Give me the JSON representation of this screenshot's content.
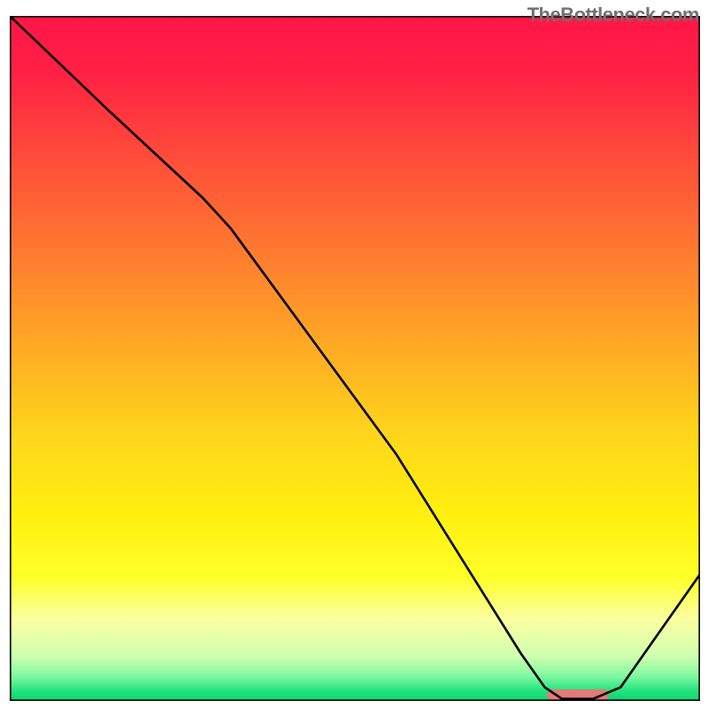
{
  "watermark_text": "TheBottleneck.com",
  "chart_data": {
    "type": "line",
    "title": "",
    "xlabel": "",
    "ylabel": "",
    "xlim": [
      0,
      100
    ],
    "ylim": [
      0,
      100
    ],
    "background_gradient": {
      "stops": [
        {
          "offset": 0.0,
          "color": "#ff1648"
        },
        {
          "offset": 0.08,
          "color": "#ff2044"
        },
        {
          "offset": 0.2,
          "color": "#ff4a3a"
        },
        {
          "offset": 0.35,
          "color": "#ff7c2f"
        },
        {
          "offset": 0.5,
          "color": "#ffb023"
        },
        {
          "offset": 0.62,
          "color": "#ffd81a"
        },
        {
          "offset": 0.73,
          "color": "#fff010"
        },
        {
          "offset": 0.82,
          "color": "#ffff28"
        },
        {
          "offset": 0.88,
          "color": "#faffa0"
        },
        {
          "offset": 0.935,
          "color": "#d0ffb0"
        },
        {
          "offset": 0.965,
          "color": "#7cf7a0"
        },
        {
          "offset": 0.985,
          "color": "#24e37e"
        },
        {
          "offset": 1.0,
          "color": "#0bd66e"
        }
      ]
    },
    "border": {
      "color": "#000000",
      "width": 3.2
    },
    "series": [
      {
        "name": "bottleneck-curve",
        "color": "#000000",
        "width": 2.6,
        "x": [
          0.0,
          14.0,
          28.0,
          32.0,
          56.0,
          74.0,
          77.5,
          80.0,
          84.5,
          88.5,
          100.0
        ],
        "y": [
          100.0,
          86.5,
          73.4,
          69.0,
          36.0,
          7.0,
          2.0,
          0.3,
          0.3,
          2.0,
          18.5
        ]
      }
    ],
    "marker": {
      "name": "optimal-range",
      "shape": "rounded-bar",
      "color": "#e07b78",
      "x_start": 77.8,
      "x_end": 86.8,
      "y": 0.9,
      "thickness_pct": 1.6
    }
  }
}
